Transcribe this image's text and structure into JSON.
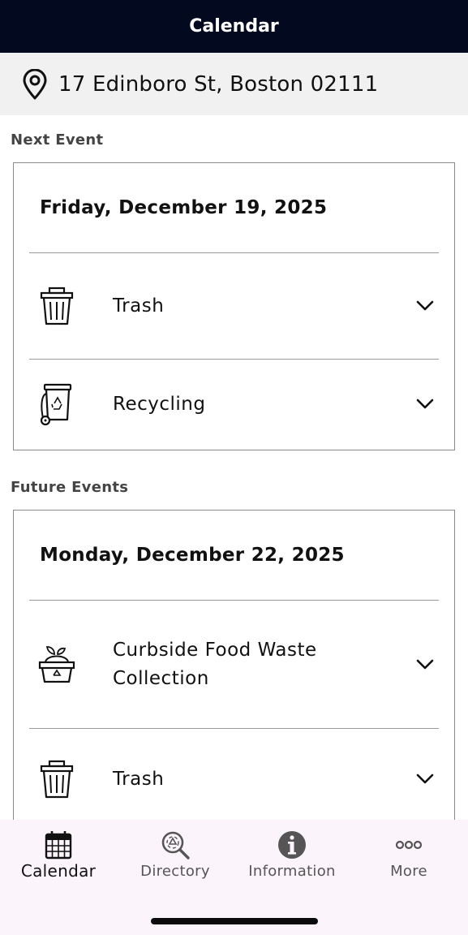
{
  "header": {
    "title": "Calendar"
  },
  "address": {
    "icon": "location-pin-icon",
    "text": "17 Edinboro St, Boston 02111"
  },
  "next_event": {
    "section_label": "Next Event",
    "date": "Friday, December 19, 2025",
    "items": [
      {
        "label": "Trash",
        "icon": "trash-can-icon"
      },
      {
        "label": "Recycling",
        "icon": "recycling-bin-icon"
      }
    ]
  },
  "future_events": {
    "section_label": "Future Events",
    "date": "Monday, December 22, 2025",
    "items": [
      {
        "label_line1": "Curbside Food Waste",
        "label_line2": "Collection",
        "icon": "food-waste-bin-icon"
      },
      {
        "label": "Trash",
        "icon": "trash-can-icon"
      }
    ]
  },
  "tabbar": {
    "tabs": [
      {
        "label": "Calendar",
        "icon": "calendar-icon",
        "active": true
      },
      {
        "label": "Directory",
        "icon": "directory-search-icon",
        "active": false
      },
      {
        "label": "Information",
        "icon": "info-icon",
        "active": false
      },
      {
        "label": "More",
        "icon": "more-dots-icon",
        "active": false
      }
    ]
  },
  "colors": {
    "header_bg": "#030a1f",
    "address_bg": "#f1f1f2",
    "tabbar_bg": "#fbf5fb"
  }
}
